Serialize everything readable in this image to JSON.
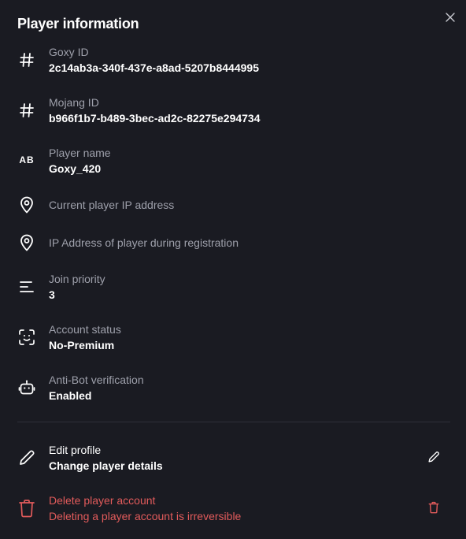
{
  "header": {
    "title": "Player information"
  },
  "fields": {
    "goxy_id": {
      "label": "Goxy ID",
      "value": "2c14ab3a-340f-437e-a8ad-5207b8444995"
    },
    "mojang_id": {
      "label": "Mojang ID",
      "value": "b966f1b7-b489-3bec-ad2c-82275e294734"
    },
    "player_name": {
      "label": "Player name",
      "value": "Goxy_420",
      "icon_text": "AB"
    },
    "current_ip": {
      "label": "Current player IP address"
    },
    "registration_ip": {
      "label": "IP Address of player during registration"
    },
    "join_priority": {
      "label": "Join priority",
      "value": "3"
    },
    "account_status": {
      "label": "Account status",
      "value": "No-Premium"
    },
    "antibot": {
      "label": "Anti-Bot verification",
      "value": "Enabled"
    }
  },
  "actions": {
    "edit": {
      "title": "Edit profile",
      "subtitle": "Change player details"
    },
    "delete": {
      "title": "Delete player account",
      "subtitle": "Deleting a player account is irreversible"
    }
  },
  "icons": {
    "close": "close-icon",
    "hash": "hash-icon",
    "text": "text-ab-icon",
    "location": "map-pin-icon",
    "priority": "sort-lines-icon",
    "status": "face-scan-icon",
    "robot": "robot-icon",
    "pencil": "pencil-icon",
    "trash": "trash-icon"
  },
  "colors": {
    "background": "#1a1b22",
    "text": "#ffffff",
    "muted": "#9ea0ab",
    "danger": "#e25b5b",
    "divider": "#2e3039"
  }
}
